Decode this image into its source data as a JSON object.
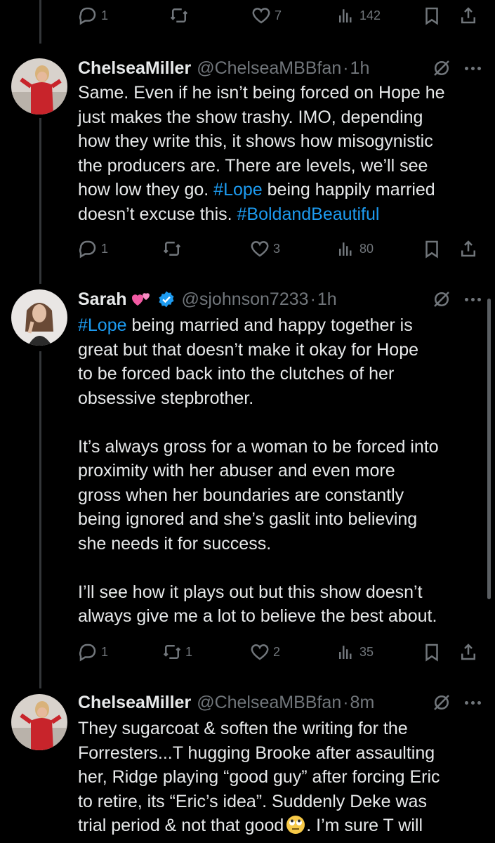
{
  "top_actions": {
    "replies": "1",
    "retweets": "",
    "likes": "7",
    "views": "142"
  },
  "tweets": [
    {
      "name": "ChelseaMiller",
      "handle": "@ChelseaMBBfan",
      "time": "1h",
      "lines": [
        "Same. Even if he isn’t being forced on Hope he",
        "just makes the show trashy. IMO, depending",
        "how they write this, it shows how misogynistic",
        "the  producers are. There are levels, we’ll see"
      ],
      "l5_pre": "how low they go. ",
      "l5_tag": "#Lope",
      "l5_post": " being happily married",
      "l6_pre": "doesn’t excuse this. ",
      "l6_tag": "#BoldandBeautiful",
      "actions": {
        "replies": "1",
        "retweets": "",
        "likes": "3",
        "views": "80"
      }
    },
    {
      "name": "Sarah",
      "handle": "@sjohnson7233",
      "time": "1h",
      "l1_tag": "#Lope",
      "l1_post": " being married and happy together is",
      "p1_lines": [
        "great but that doesn’t make it okay for Hope",
        "to be forced back into the clutches of her",
        "obsessive stepbrother."
      ],
      "p2_lines": [
        "It’s always gross for a woman to be forced into",
        "proximity with her abuser and even more",
        "gross when her boundaries are constantly",
        "being ignored and she’s gaslit into believing",
        "she needs it for success."
      ],
      "p3_lines": [
        "I’ll see how it plays out but this show doesn’t",
        "always give me a lot to believe the best about."
      ],
      "actions": {
        "replies": "1",
        "retweets": "1",
        "likes": "2",
        "views": "35"
      }
    },
    {
      "name": "ChelseaMiller",
      "handle": "@ChelseaMBBfan",
      "time": "8m",
      "lines": [
        "They sugarcoat & soften the writing for the",
        "Forresters...T hugging Brooke after assaulting",
        "her, Ridge playing “good guy” after forcing Eric",
        "to retire, its “Eric’s idea”. Suddenly Deke was"
      ],
      "last_pre": "trial period & not that good",
      "last_post": ". I’m sure T will"
    }
  ],
  "colors": {
    "link": "#1d9bf0",
    "muted": "#71767b",
    "text": "#e7e9ea",
    "bg": "#000000"
  }
}
